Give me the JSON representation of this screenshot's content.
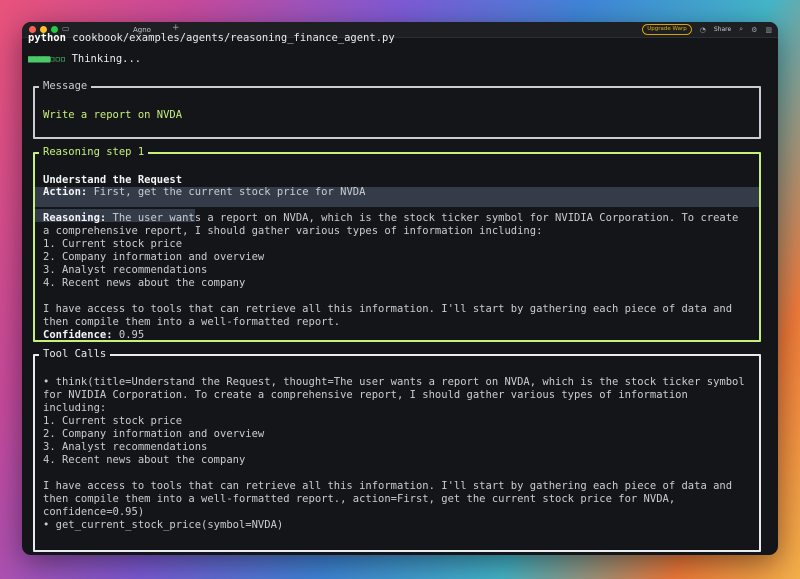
{
  "titlebar": {
    "tab_title": "Agno",
    "plus": "+",
    "upgrade_label": "Upgrade Warp",
    "share_label": "Share"
  },
  "terminal": {
    "command_prefix": "python",
    "command_path": "cookbook/examples/agents/reasoning_finance_agent.py",
    "spinner_glyphs": "■■■■▫▫▫",
    "spinner_text": "Thinking..."
  },
  "message_panel": {
    "label": "Message",
    "text": "Write a report on NVDA"
  },
  "reasoning_panel": {
    "label": "Reasoning step 1",
    "step_title": "Understand the Request",
    "action_label": "Action:",
    "action_text": " First, get the current stock price for NVDA",
    "reasoning_label": "Reasoning:",
    "reasoning_lines": [
      " The user wants a report on NVDA, which is the stock ticker symbol for NVIDIA Corporation. To create",
      "a comprehensive report, I should gather various types of information including:",
      "1. Current stock price",
      "2. Company information and overview",
      "3. Analyst recommendations",
      "4. Recent news about the company",
      "",
      "I have access to tools that can retrieve all this information. I'll start by gathering each piece of data and",
      "then compile them into a well-formatted report."
    ],
    "confidence_label": "Confidence:",
    "confidence_value": " 0.95"
  },
  "tool_calls_panel": {
    "label": "Tool Calls",
    "lines": [
      "• think(title=Understand the Request, thought=The user wants a report on NVDA, which is the stock ticker symbol",
      "for NVIDIA Corporation. To create a comprehensive report, I should gather various types of information",
      "including:",
      "1. Current stock price",
      "2. Company information and overview",
      "3. Analyst recommendations",
      "4. Recent news about the company",
      "",
      "I have access to tools that can retrieve all this information. I'll start by gathering each piece of data and",
      "then compile them into a well-formatted report., action=First, get the current stock price for NVDA,",
      "confidence=0.95)",
      "• get_current_stock_price(symbol=NVDA)"
    ]
  }
}
